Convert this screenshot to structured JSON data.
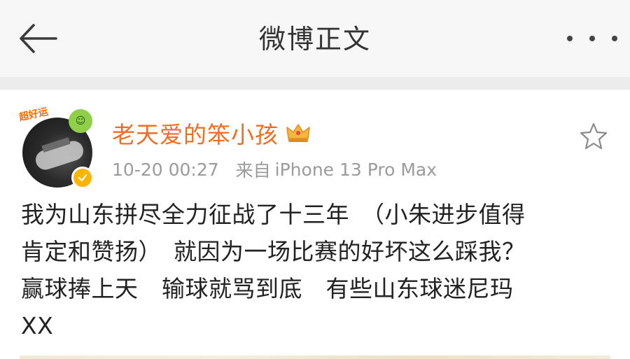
{
  "nav": {
    "title": "微博正文",
    "back_icon": "arrow-left-icon",
    "more_icon": "more-dots-icon"
  },
  "post": {
    "avatar_sticker": "超好运",
    "username": "老天爱的笨小孩",
    "badge_icon": "crown-icon",
    "verified_icon": "verified-badge-icon",
    "timestamp": "10-20 00:27",
    "source_prefix": "来自",
    "source_device": "iPhone 13 Pro Max",
    "star_icon": "star-outline-icon",
    "text_lines": [
      "我为山东拼尽全力征战了十三年　（小朱进步值得",
      "肯定和赞扬）　就因为一场比赛的好坏这么踩我？",
      "赢球捧上天　输球就骂到底　有些山东球迷尼玛",
      "XX"
    ]
  },
  "colors": {
    "username": "#f26d1f",
    "meta": "#9b9b9b",
    "nav_bg": "#f7f7f7",
    "verified": "#ffb400"
  }
}
